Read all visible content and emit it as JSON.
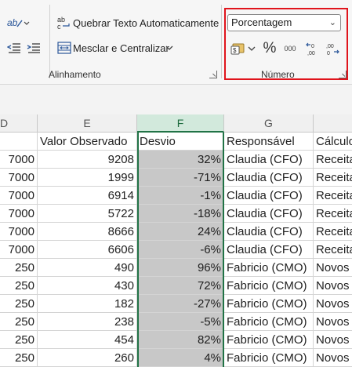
{
  "ribbon": {
    "wrap_text_label": "Quebrar Texto Automaticamente",
    "merge_center_label": "Mesclar e Centralizar",
    "alignment_group": "Alinhamento",
    "number_group": "Número",
    "number_format_value": "Porcentagem",
    "percent_symbol": "%",
    "comma_symbol": "000"
  },
  "columns": [
    {
      "letter": "D"
    },
    {
      "letter": "E"
    },
    {
      "letter": "F"
    },
    {
      "letter": "G"
    },
    {
      "letter": ""
    }
  ],
  "header_row": [
    "",
    "Valor Observado",
    "Desvio",
    "Responsável",
    "Cálculo"
  ],
  "rows": [
    [
      "7000",
      "9208",
      "32%",
      "Claudia (CFO)",
      "Receita"
    ],
    [
      "7000",
      "1999",
      "-71%",
      "Claudia (CFO)",
      "Receita"
    ],
    [
      "7000",
      "6914",
      "-1%",
      "Claudia (CFO)",
      "Receita"
    ],
    [
      "7000",
      "5722",
      "-18%",
      "Claudia (CFO)",
      "Receita"
    ],
    [
      "7000",
      "8666",
      "24%",
      "Claudia (CFO)",
      "Receita"
    ],
    [
      "7000",
      "6606",
      "-6%",
      "Claudia (CFO)",
      "Receita"
    ],
    [
      "250",
      "490",
      "96%",
      "Fabricio (CMO)",
      "Novos"
    ],
    [
      "250",
      "430",
      "72%",
      "Fabricio (CMO)",
      "Novos"
    ],
    [
      "250",
      "182",
      "-27%",
      "Fabricio (CMO)",
      "Novos"
    ],
    [
      "250",
      "238",
      "-5%",
      "Fabricio (CMO)",
      "Novos"
    ],
    [
      "250",
      "454",
      "82%",
      "Fabricio (CMO)",
      "Novos"
    ],
    [
      "250",
      "260",
      "4%",
      "Fabricio (CMO)",
      "Novos"
    ]
  ]
}
